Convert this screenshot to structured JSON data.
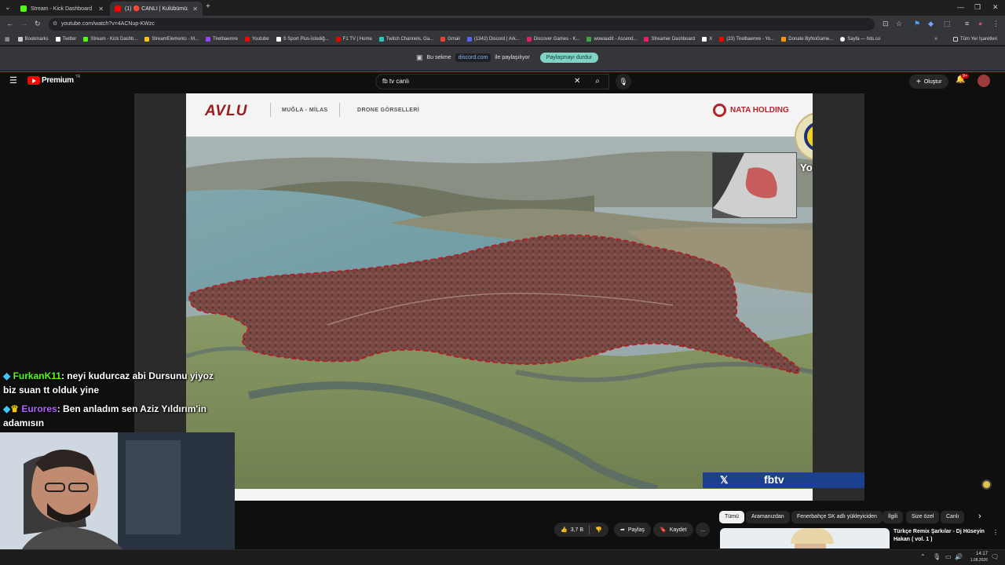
{
  "browser": {
    "tabs": [
      {
        "title": "Stream - Kick Dashboard",
        "color": "#53fc18"
      },
      {
        "title": "(1) 🔴 CANLI | Kulübümüzü...",
        "color": "#ff0000"
      }
    ],
    "new_tab": "+",
    "url": "youtube.com/watch?v=4ACNup-KWzc",
    "bookmarks": [
      {
        "label": "Bookmarks",
        "color": "#cccccc"
      },
      {
        "label": "Twitter",
        "color": "#ffffff"
      },
      {
        "label": "Stream - Kick Dashb...",
        "color": "#53fc18"
      },
      {
        "label": "StreamElements - M...",
        "color": "#f5c518"
      },
      {
        "label": "Tirelbaemre",
        "color": "#9147ff"
      },
      {
        "label": "Youtube",
        "color": "#ff0000"
      },
      {
        "label": "S Sport Plus-İstediğ...",
        "color": "#ffffff"
      },
      {
        "label": "F1 TV | Home",
        "color": "#e10600"
      },
      {
        "label": "Twitch Channels, Ga...",
        "color": "#2ec4b6"
      },
      {
        "label": "Gmail",
        "color": "#ea4335"
      },
      {
        "label": "(1342) Discord | Ark...",
        "color": "#5865f2"
      },
      {
        "label": "Discover Games - K...",
        "color": "#e91e63"
      },
      {
        "label": "wowaudit - Ascend...",
        "color": "#43a047"
      },
      {
        "label": "Streamer Dashboard",
        "color": "#e91e63"
      },
      {
        "label": "X",
        "color": "#ffffff"
      },
      {
        "label": "(23) Tirelbaemre - Yo...",
        "color": "#ff0000"
      },
      {
        "label": "Donate ByNoGame...",
        "color": "#ff9800"
      },
      {
        "label": "Sayfa — hits.co",
        "color": "#ffffff"
      }
    ],
    "all_bookmarks": "Tüm Yer İşaretleri",
    "share_notice": {
      "prefix": "Bu sekme",
      "domain": "discord.com",
      "suffix": "ile paylaşılıyor",
      "stop_button": "Paylaşmayı durdur"
    }
  },
  "youtube": {
    "logo": "Premium",
    "logo_region": "TR",
    "search_query": "fb tv canlı",
    "create_button": "Oluştur",
    "notification_count": "9+"
  },
  "video": {
    "slide_brand": "AVLU",
    "slide_location": "MUĞLA - MİLAS",
    "slide_section": "DRONE GÖRSELLERİ",
    "slide_company": "NATA HOLDING",
    "channel_watermark": "YouTube",
    "banner_text": "fbtv"
  },
  "chat": [
    {
      "user": "FurkanK11",
      "user_color": "#53fc18",
      "message": ": neyi kudurcaz abi Dursunu yiyoz biz suan tt olduk yine"
    },
    {
      "user": "Eurores",
      "user_color": "#b362ff",
      "message": ": Ben anladım sen Aziz Yıldırım'in adamısın"
    }
  ],
  "actions": {
    "like_count": "3,7 B",
    "share": "Paylaş",
    "save": "Kaydet",
    "more": "..."
  },
  "chips": [
    "Tümü",
    "Aramanızdan",
    "Fenerbahçe SK adlı yükleyiciden",
    "İlgili",
    "Size özel",
    "Canlı"
  ],
  "recommended": {
    "title": "Türkçe Remix Şarkılar - Dj Hüseyin Hakan ( vol. 1 )"
  },
  "taskbar": {
    "time": "14:17",
    "date": "1.08.2026"
  }
}
